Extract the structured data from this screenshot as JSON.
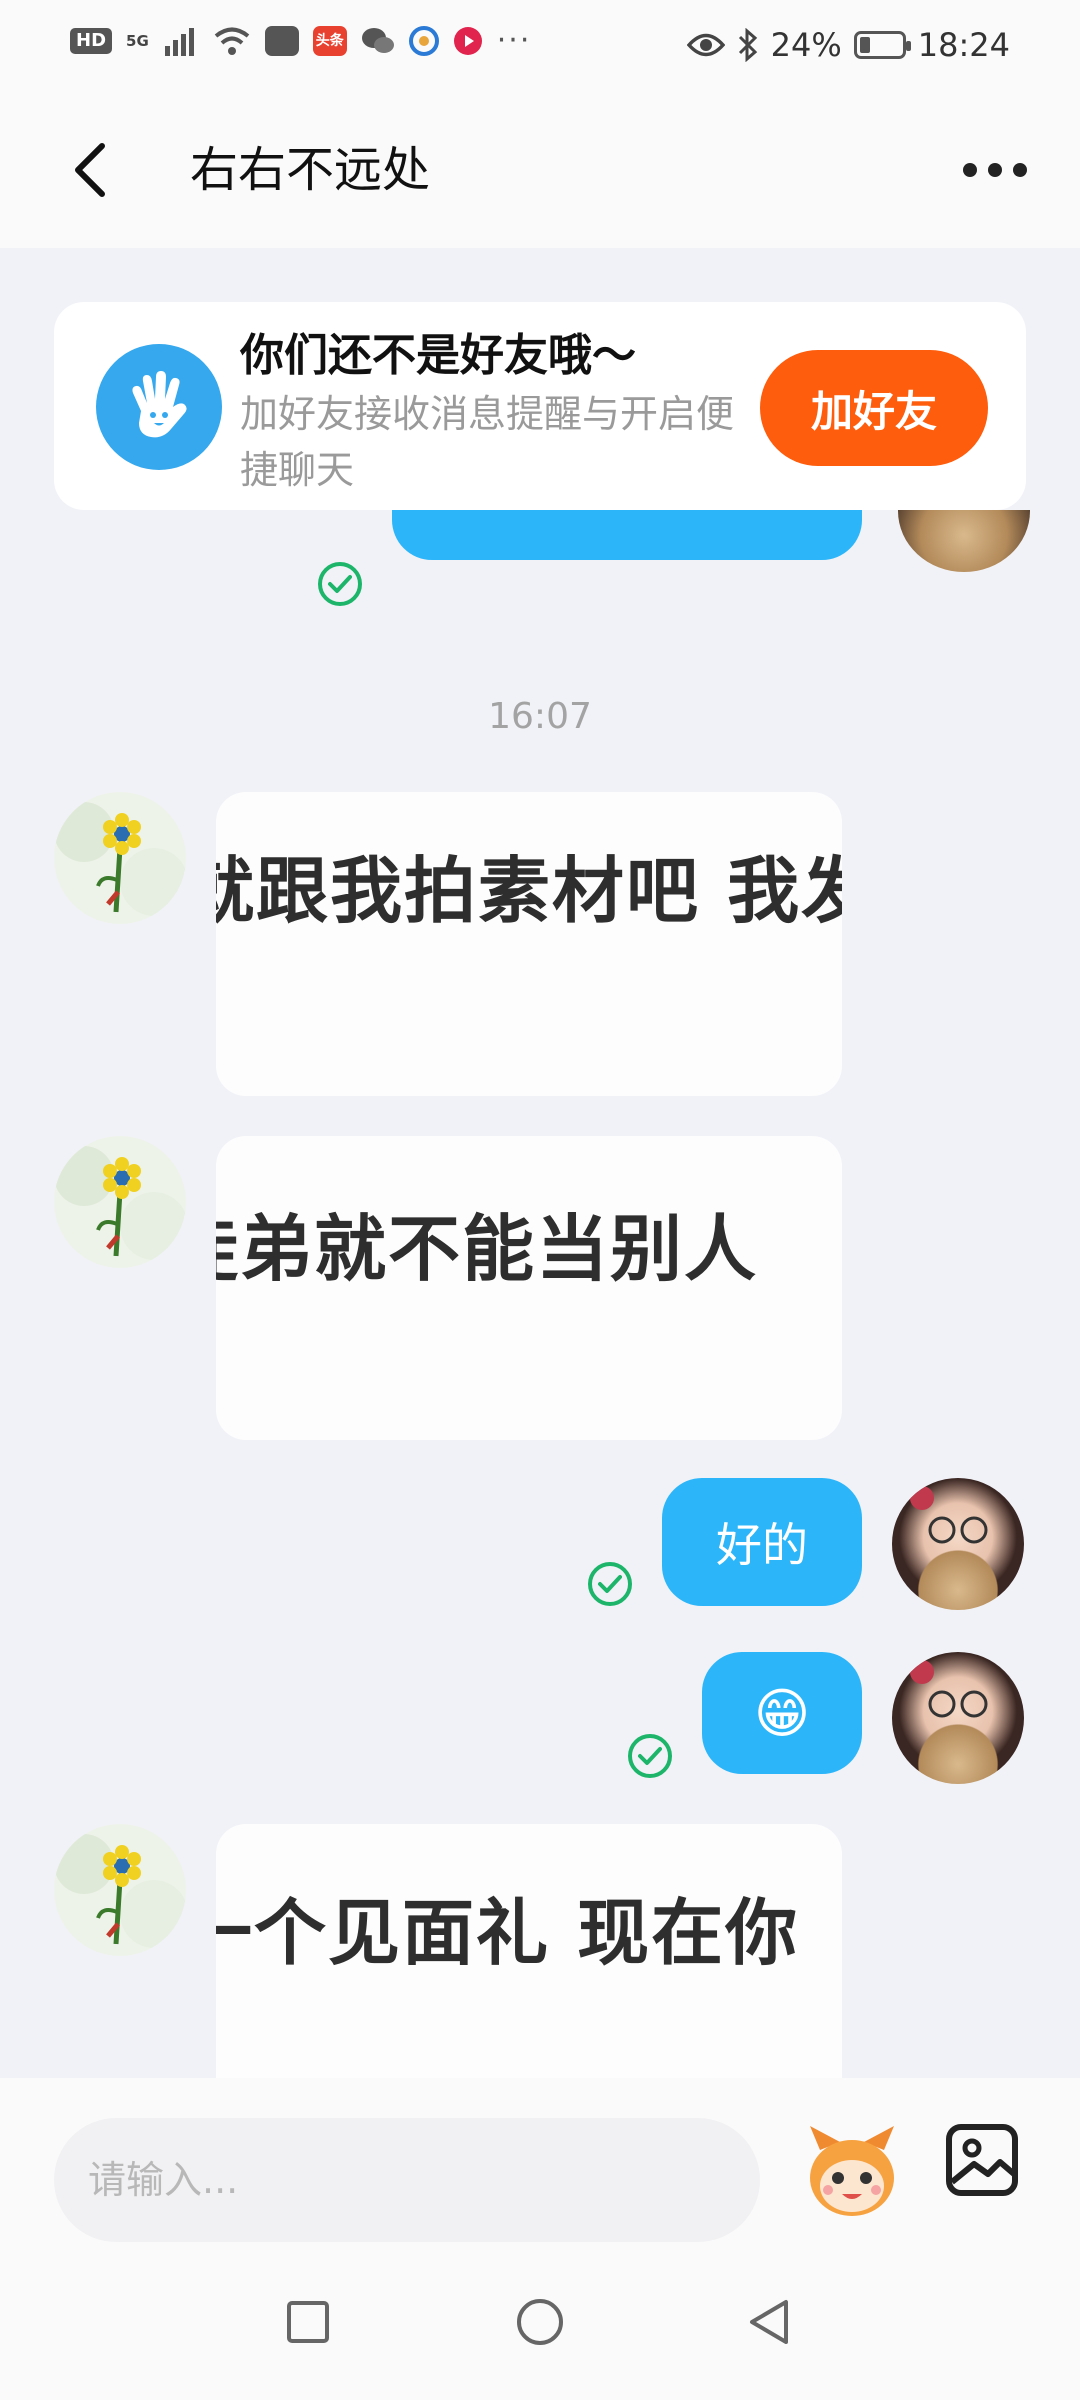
{
  "status_bar": {
    "left_badge": "HD",
    "signal": "5G",
    "app_badge": "头条",
    "more": "···",
    "battery": "24%",
    "battery_level": 0.24,
    "time": "18:24"
  },
  "header": {
    "title": "右右不远处",
    "back_icon": "chevron-left-icon",
    "more_icon": "more-horizontal-icon"
  },
  "friend_banner": {
    "title": "你们还不是好友哦～",
    "subtitle": "加好友接收消息提醒与开启便捷聊天",
    "button": "加好友",
    "icon": "hand-wave-icon",
    "button_color": "#fd5d0c"
  },
  "messages": {
    "timestamp": "16:07",
    "items": [
      {
        "side": "right",
        "type": "text",
        "text": ""
      },
      {
        "side": "left",
        "type": "image",
        "text": "就跟我拍素材吧 我发"
      },
      {
        "side": "left",
        "type": "image",
        "text": "徒弟就不能当别人"
      },
      {
        "side": "right",
        "type": "text",
        "text": "好的"
      },
      {
        "side": "right",
        "type": "text",
        "text": "😁"
      },
      {
        "side": "left",
        "type": "image",
        "text": "一个见面礼 现在你"
      }
    ]
  },
  "input_bar": {
    "placeholder": "请输入...",
    "emoji_icon": "mascot-icon",
    "image_icon": "image-icon"
  },
  "nav_bar": {
    "recent_icon": "square-icon",
    "home_icon": "circle-icon",
    "back_icon": "triangle-back-icon"
  },
  "colors": {
    "accent_blue": "#2cb6f9",
    "send_check": "#1db56a",
    "background": "#f1f2f7"
  }
}
